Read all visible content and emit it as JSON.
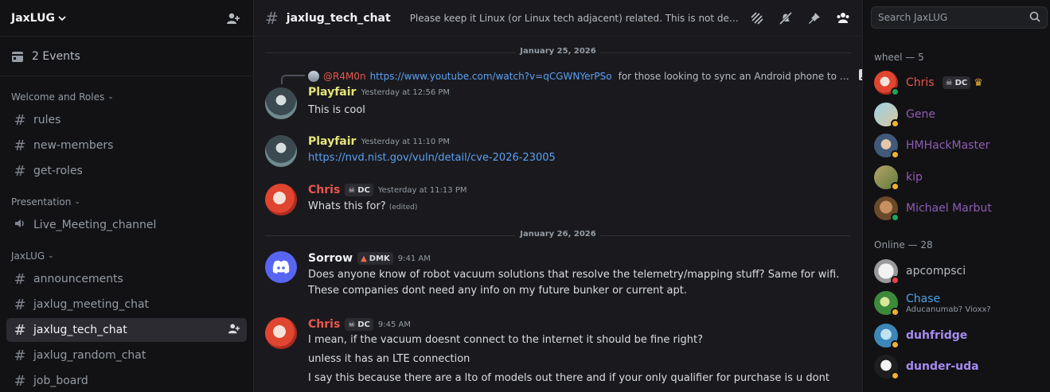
{
  "server": {
    "name": "JaxLUG",
    "events_label": "2 Events"
  },
  "categories": [
    {
      "name": "Welcome and Roles",
      "channels": [
        "rules",
        "new-members",
        "get-roles"
      ]
    },
    {
      "name": "Presentation",
      "channels": [
        "Live_Meeting_channel"
      ]
    },
    {
      "name": "JaxLUG",
      "channels": [
        "announcements",
        "jaxlug_meeting_chat",
        "jaxlug_tech_chat",
        "jaxlug_random_chat",
        "job_board"
      ]
    }
  ],
  "channel": {
    "name": "jaxlug_tech_chat",
    "topic": "Please keep it Linux (or Linux tech adjacent) related. This is not designed to be a general tech chat."
  },
  "search": {
    "placeholder": "Search JaxLUG"
  },
  "dates": [
    "January 25, 2026",
    "January 26, 2026"
  ],
  "reply": {
    "user": "@R4M0n",
    "link": "https://www.youtube.com/watch?v=qCGWNYerPSo",
    "text": "for those looking to sync an Android phone to …"
  },
  "messages": [
    {
      "user": "Playfair",
      "time": "Yesterday at 12:56 PM",
      "text": "This is cool"
    },
    {
      "user": "Playfair",
      "time": "Yesterday at 11:10 PM",
      "text": "https://nvd.nist.gov/vuln/detail/cve-2026-23005"
    },
    {
      "user": "Chris",
      "tag": "DC",
      "time": "Yesterday at 11:13 PM",
      "text": "Whats this for?",
      "edited": "(edited)"
    },
    {
      "user": "Sorrow",
      "tag": "DMK",
      "time": "9:41 AM",
      "line1": "Does anyone know of robot vacuum solutions that resolve the telemetry/mapping stuff? Same for wifi.",
      "line2": "These companies dont need any info on my future bunker or current apt."
    },
    {
      "user": "Chris",
      "tag": "DC",
      "time": "9:45 AM",
      "line1": "I mean, if the vacuum doesnt connect to the internet it should be fine right?",
      "line2": "unless it has an LTE connection",
      "line3": "I say this because there are a lto of models out there and if your only qualifier for purchase is u dont"
    }
  ],
  "members": {
    "group1_label": "wheel — 5",
    "group2_label": "Online — 28",
    "wheel": [
      {
        "name": "Chris",
        "tag": "DC",
        "color": "#e8584f"
      },
      {
        "name": "Gene",
        "color": "#8f5bb5"
      },
      {
        "name": "HMHackMaster",
        "color": "#8f5bb5"
      },
      {
        "name": "kip",
        "color": "#8f5bb5"
      },
      {
        "name": "Michael Marbut",
        "color": "#8f5bb5"
      }
    ],
    "online": [
      {
        "name": "apcompsci",
        "color": "#b5bac1"
      },
      {
        "name": "Chase",
        "sub": "Aducanumab? Vioxx?",
        "color": "#4aa3e8"
      },
      {
        "name": "duhfridge",
        "color": "#a58cf0"
      },
      {
        "name": "dunder-uda",
        "color": "#a58cf0"
      }
    ]
  },
  "colors": {
    "playfair": "#e6e57a",
    "chris": "#e8584f",
    "sorrow": "#f2f3f5",
    "reply_user": "#e8584f",
    "link": "#5aa0f2"
  }
}
